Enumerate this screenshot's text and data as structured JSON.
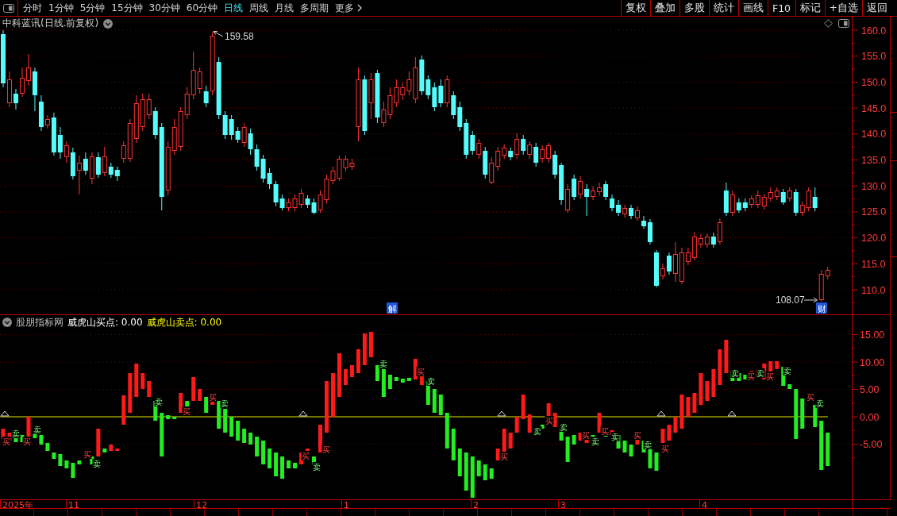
{
  "toolbar": {
    "periods": [
      {
        "label": "分时",
        "selected": false
      },
      {
        "label": "1分钟",
        "selected": false
      },
      {
        "label": "5分钟",
        "selected": false
      },
      {
        "label": "15分钟",
        "selected": false
      },
      {
        "label": "30分钟",
        "selected": false
      },
      {
        "label": "60分钟",
        "selected": false
      },
      {
        "label": "日线",
        "selected": true
      },
      {
        "label": "周线",
        "selected": false
      },
      {
        "label": "月线",
        "selected": false
      },
      {
        "label": "多周期",
        "selected": false
      }
    ],
    "more": "更多",
    "buttons": [
      "复权",
      "叠加",
      "多股",
      "统计",
      "画线",
      "F10",
      "标记",
      "+自选",
      "返回"
    ]
  },
  "price_panel": {
    "title": "中科蓝讯(日线.前复权)",
    "axis_labels": [
      "160.0",
      "155.0",
      "150.0",
      "145.0",
      "140.0",
      "135.0",
      "130.0",
      "125.0",
      "120.0",
      "115.0",
      "110.0"
    ],
    "high_label": "159.58",
    "low_label": "108.07",
    "event_markers": [
      "解",
      "财"
    ]
  },
  "indicator_panel": {
    "source": "股朋指标网",
    "readings": [
      {
        "label": "威虎山买点: 0.00",
        "color": "#ffffff"
      },
      {
        "label": "威虎山卖点: 0.00",
        "color": "#ffff00"
      }
    ],
    "axis_labels": [
      "15.00",
      "10.00",
      "5.00",
      "0.00",
      "-5.00"
    ],
    "signals": [
      {
        "kind": "buy",
        "text": "买"
      },
      {
        "kind": "sell",
        "text": "卖"
      },
      {
        "kind": "buy",
        "text": "买"
      },
      {
        "kind": "sell",
        "text": "卖"
      },
      {
        "kind": "buy",
        "text": "买"
      },
      {
        "kind": "sell",
        "text": "卖"
      },
      {
        "kind": "sell",
        "text": "卖"
      },
      {
        "kind": "buy",
        "text": "买"
      },
      {
        "kind": "buy",
        "text": "买"
      },
      {
        "kind": "sell",
        "text": "卖"
      },
      {
        "kind": "buy",
        "text": "买"
      },
      {
        "kind": "sell",
        "text": "卖"
      },
      {
        "kind": "buy",
        "text": "买"
      },
      {
        "kind": "sell",
        "text": "卖"
      },
      {
        "kind": "buy",
        "text": "买"
      },
      {
        "kind": "sell",
        "text": "卖"
      },
      {
        "kind": "buy",
        "text": "买"
      },
      {
        "kind": "sell",
        "text": "卖"
      },
      {
        "kind": "buy",
        "text": "买"
      },
      {
        "kind": "sell",
        "text": "卖"
      },
      {
        "kind": "buy",
        "text": "买"
      },
      {
        "kind": "sell",
        "text": "卖"
      },
      {
        "kind": "buy",
        "text": "买"
      },
      {
        "kind": "sell",
        "text": "卖"
      },
      {
        "kind": "buy",
        "text": "买"
      },
      {
        "kind": "sell",
        "text": "卖"
      },
      {
        "kind": "buy",
        "text": "买"
      },
      {
        "kind": "sell",
        "text": "卖"
      },
      {
        "kind": "buy",
        "text": "买"
      },
      {
        "kind": "sell",
        "text": "卖"
      },
      {
        "kind": "buy",
        "text": "买"
      },
      {
        "kind": "sell",
        "text": "卖"
      },
      {
        "kind": "buy",
        "text": "买"
      },
      {
        "kind": "sell",
        "text": "卖"
      }
    ]
  },
  "date_axis": {
    "labels": [
      "2025年",
      "11",
      "12",
      "1",
      "2",
      "3",
      "4"
    ]
  }
}
